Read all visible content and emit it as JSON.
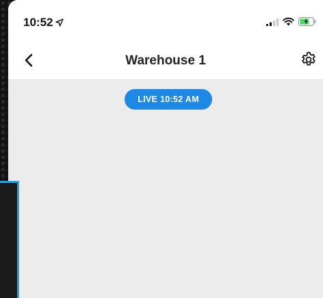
{
  "status_bar": {
    "time": "10:52",
    "location_icon": "location-arrow-icon",
    "signal_icon": "cellular-signal-icon",
    "wifi_icon": "wifi-icon",
    "battery_icon": "battery-charging-icon"
  },
  "nav": {
    "title": "Warehouse 1",
    "back_icon": "chevron-left-icon",
    "settings_icon": "gear-icon"
  },
  "live_badge": {
    "label": "LIVE 10:52 AM",
    "color": "#1e88e5"
  },
  "colors": {
    "page_background": "#ececec",
    "overlay_border": "#1aa7ec"
  }
}
